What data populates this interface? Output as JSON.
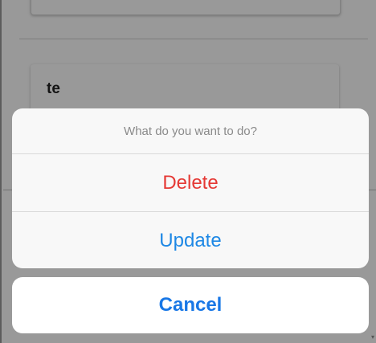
{
  "background_page": {
    "card_title": "te"
  },
  "action_sheet": {
    "title": "What do you want to do?",
    "actions": [
      {
        "label": "Delete",
        "color": "#e53935"
      },
      {
        "label": "Update",
        "color": "#1e88e5"
      }
    ],
    "cancel_label": "Cancel",
    "cancel_color": "#1877e6"
  },
  "icons": {
    "scroll_down": "▾"
  }
}
